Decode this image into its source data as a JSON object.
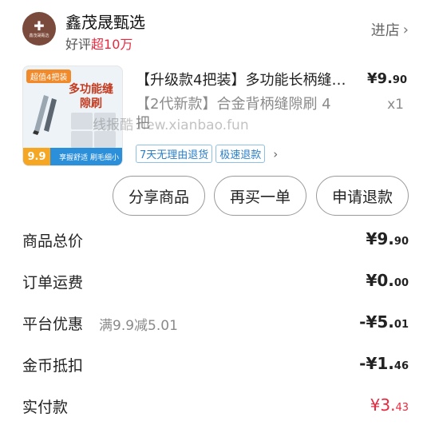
{
  "shop": {
    "name": "鑫茂晟甄选",
    "rating_prefix": "好评",
    "rating_highlight": "超10万",
    "enter_label": "进店",
    "logo_mini_text": "鑫茂晟甄选"
  },
  "product": {
    "thumb_badge": "超值4把装",
    "thumb_title": "多功能缝隙刷",
    "thumb_price": "9.9",
    "thumb_bottom": "享握舒适 刷毛细小",
    "title": "【升级款4把装】多功能长柄缝隙刷…",
    "price_int": "¥9.",
    "price_dec": "90",
    "spec": "【2代新款】合金背柄缝隙刷 4把",
    "qty": "x1",
    "watermark": "线报酷 new.xianbao.fun",
    "tags": [
      "7天无理由退货",
      "极速退款"
    ]
  },
  "actions": {
    "share": "分享商品",
    "rebuy": "再买一单",
    "refund": "申请退款"
  },
  "summary": {
    "total_label": "商品总价",
    "total_int": "¥9.",
    "total_dec": "90",
    "shipping_label": "订单运费",
    "shipping_int": "¥0.",
    "shipping_dec": "00",
    "discount_label": "平台优惠",
    "discount_sub": "满9.9减5.01",
    "discount_int": "-¥5.",
    "discount_dec": "01",
    "coin_label": "金币抵扣",
    "coin_int": "-¥1.",
    "coin_dec": "46",
    "paid_label": "实付款",
    "paid_int": "¥3.",
    "paid_dec": "43"
  },
  "colors": {
    "accent_red": "#e8283f",
    "tag_blue": "#2a7fc7"
  }
}
